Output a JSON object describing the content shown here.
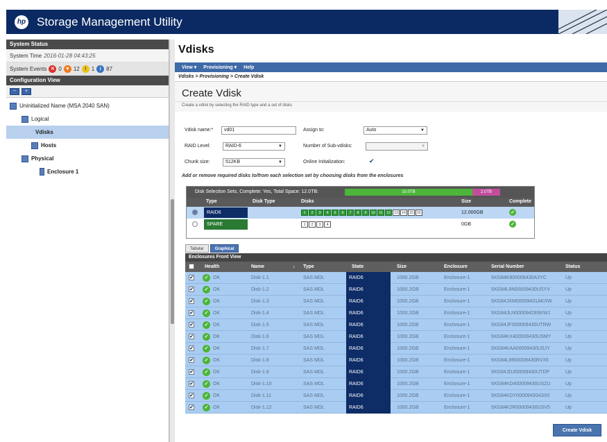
{
  "app": {
    "title": "Storage Management Utility",
    "logo": "hp"
  },
  "left_panel": {
    "system_status_header": "System Status",
    "system_time_label": "System Time",
    "system_time_value": "2016-01-28 04:43:25",
    "system_events_label": "System Events",
    "events": [
      {
        "icon": "critical-icon",
        "count": "0",
        "color": "#d9322b"
      },
      {
        "icon": "error-icon",
        "count": "12",
        "color": "#f07a1a"
      },
      {
        "icon": "warning-icon",
        "count": "1",
        "color": "#f0c419"
      },
      {
        "icon": "info-icon",
        "count": "87",
        "color": "#3a72c4"
      }
    ],
    "config_view_header": "Configuration View",
    "tree": {
      "root": "Uninitialized Name (MSA 2040 SAN)",
      "logical": "Logical",
      "vdisks": "Vdisks",
      "hosts": "Hosts",
      "physical": "Physical",
      "enclosure": "Enclosure 1"
    }
  },
  "main": {
    "page_title": "Vdisks",
    "menu": [
      "View ▾",
      "Provisioning ▾",
      "Help"
    ],
    "breadcrumb": "Vdisks > Provisioning > Create Vdisk",
    "form_title": "Create Vdisk",
    "form_subtitle": "Create a vdisk by selecting the RAID type and a set of disks",
    "fields": {
      "vdisk_name_label": "Vdisk name:*",
      "vdisk_name_value": "vd01",
      "raid_level_label": "RAID Level:",
      "raid_level_value": "RAID-6",
      "chunk_size_label": "Chunk size:",
      "chunk_size_value": "512KB",
      "assign_to_label": "Assign to:",
      "assign_to_value": "Auto",
      "sub_vdisks_label": "Number of Sub-vdisks:",
      "sub_vdisks_value": "",
      "online_init_label": "Online Initialization:",
      "online_init_checked": true
    },
    "instruction": "Add or remove required disks to/from each selection set by choosing disks from the enclosures",
    "selection_sets": {
      "summary": "Disk Selection Sets, Complete: Yes, Total Space: 12.0TB:",
      "used_label": "10.0TB",
      "parity_label": "2.0TB",
      "columns": [
        "Type",
        "Disk Type",
        "Disks",
        "Size",
        "Complete"
      ],
      "rows": [
        {
          "type": "RAID6",
          "disk_type": "",
          "disks_selected": [
            "1",
            "2",
            "3",
            "4",
            "5",
            "6",
            "7",
            "8",
            "9",
            "10",
            "11",
            "12"
          ],
          "disks_empty": [
            "13",
            "14",
            "15",
            "16"
          ],
          "size": "12.000GB",
          "complete": true,
          "selected": true
        },
        {
          "type": "SPARE",
          "disk_type": "",
          "disks_selected": [],
          "disks_empty": [
            "1",
            "2",
            "3",
            "4"
          ],
          "size": "0GB",
          "complete": true,
          "selected": false
        }
      ]
    },
    "tabs": [
      "Tabular",
      "Graphical"
    ],
    "active_tab": "Graphical",
    "enclosure_view": {
      "title": "Enclosures Front View",
      "columns": [
        "Health",
        "Name",
        "Type",
        "State",
        "Size",
        "Enclosure",
        "Serial Number",
        "Status"
      ],
      "rows": [
        {
          "health": "OK",
          "name": "Disk-1.1",
          "type": "SAS MDL",
          "state": "RAID6",
          "size": "1000.2GB",
          "enclosure": "Enclosure-1",
          "serial": "9XG84K800009430A3YC",
          "status": "Up"
        },
        {
          "health": "OK",
          "name": "Disk-1.2",
          "type": "SAS MDL",
          "state": "RAID6",
          "size": "1000.2GB",
          "enclosure": "Enclosure-1",
          "serial": "9XG84L9N00009430USYV",
          "status": "Up"
        },
        {
          "health": "OK",
          "name": "Disk-1.3",
          "type": "SAS MDL",
          "state": "RAID6",
          "size": "1000.2GB",
          "enclosure": "Enclosure-1",
          "serial": "9XG84JXM00009431AKXW",
          "status": "Up"
        },
        {
          "health": "OK",
          "name": "Disk-1.4",
          "type": "SAS MDL",
          "state": "RAID6",
          "size": "1000.2GB",
          "enclosure": "Enclosure-1",
          "serial": "9XG84JLN00009429SKWJ",
          "status": "Up"
        },
        {
          "health": "OK",
          "name": "Disk-1.5",
          "type": "SAS MDL",
          "state": "RAID6",
          "size": "1000.2GB",
          "enclosure": "Enclosure-1",
          "serial": "9XG84JFS00009430UTRW",
          "status": "Up"
        },
        {
          "health": "OK",
          "name": "Disk-1.6",
          "type": "SAS MDL",
          "state": "RAID6",
          "size": "1000.2GB",
          "enclosure": "Enclosure-1",
          "serial": "9XG84KX400009430USMY",
          "status": "Up"
        },
        {
          "health": "OK",
          "name": "Disk-1.7",
          "type": "SAS MDL",
          "state": "RAID6",
          "size": "1000.2GB",
          "enclosure": "Enclosure-1",
          "serial": "9XG84KAA00009430USJY",
          "status": "Up"
        },
        {
          "health": "OK",
          "name": "Disk-1.8",
          "type": "SAS MDL",
          "state": "RAID6",
          "size": "1000.2GB",
          "enclosure": "Enclosure-1",
          "serial": "9XG84L8900009430RVX5",
          "status": "Up"
        },
        {
          "health": "OK",
          "name": "Disk-1.9",
          "type": "SAS MDL",
          "state": "RAID6",
          "size": "1000.2GB",
          "enclosure": "Enclosure-1",
          "serial": "9XG84JDJ00009430UTDP",
          "status": "Up"
        },
        {
          "health": "OK",
          "name": "Disk-1.10",
          "type": "SAS MDL",
          "state": "RAID6",
          "size": "1000.2GB",
          "enclosure": "Enclosure-1",
          "serial": "9XG84KD400009430USZU",
          "status": "Up"
        },
        {
          "health": "OK",
          "name": "Disk-1.11",
          "type": "SAS MDL",
          "state": "RAID6",
          "size": "1000.2GB",
          "enclosure": "Enclosure-1",
          "serial": "9XG84KDY00009430A3X0",
          "status": "Up"
        },
        {
          "health": "OK",
          "name": "Disk-1.12",
          "type": "SAS MDL",
          "state": "RAID6",
          "size": "1000.2GB",
          "enclosure": "Enclosure-1",
          "serial": "9XG84K2R00009430USV5",
          "status": "Up"
        }
      ]
    },
    "create_button": "Create Vdisk"
  }
}
